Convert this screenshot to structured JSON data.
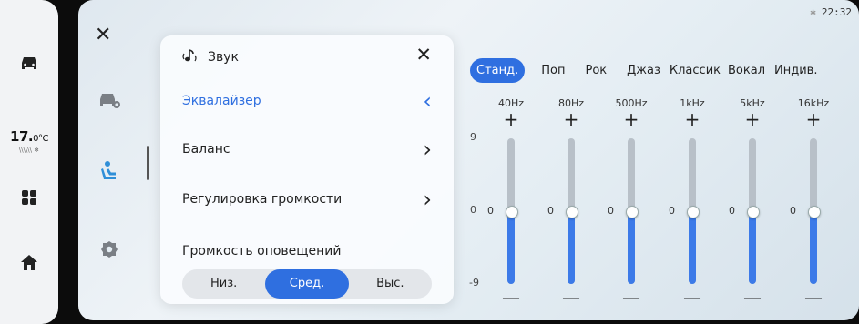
{
  "rail": {
    "temperature": "17.0°C",
    "temperature_value": "17.",
    "temperature_unit": "0°C",
    "fan_indicator": "\\\\\\\\\\\\ ❄",
    "items": [
      "car-icon",
      "temperature-display",
      "apps-grid-icon",
      "home-icon"
    ]
  },
  "status": {
    "bluetooth": "✱",
    "time": "22:32"
  },
  "sidebar_icons": [
    "car-settings-icon",
    "seat-icon",
    "gear-icon"
  ],
  "panel": {
    "title": "Звук",
    "menu": [
      {
        "label": "Эквалайзер",
        "chevron": "‹",
        "active": true
      },
      {
        "label": "Баланс",
        "chevron": "›",
        "active": false
      },
      {
        "label": "Регулировка громкости",
        "chevron": "›",
        "active": false
      }
    ],
    "notifications_label": "Громкость оповещений",
    "levels": [
      "Низ.",
      "Сред.",
      "Выс."
    ],
    "selected_level": "Сред."
  },
  "presets": {
    "items": [
      "Станд.",
      "Поп",
      "Рок",
      "Джаз",
      "Классик",
      "Вокал",
      "Индив."
    ],
    "selected": "Станд."
  },
  "equalizer": {
    "scale_max": "9",
    "scale_zero": "0",
    "scale_min": "-9",
    "range": [
      -9,
      9
    ],
    "bands": [
      {
        "freq": "40Hz",
        "value": 0,
        "label": "0"
      },
      {
        "freq": "80Hz",
        "value": 0,
        "label": "0"
      },
      {
        "freq": "500Hz",
        "value": 0,
        "label": "0"
      },
      {
        "freq": "1kHz",
        "value": 0,
        "label": "0"
      },
      {
        "freq": "5kHz",
        "value": 0,
        "label": "0"
      },
      {
        "freq": "16kHz",
        "value": 0,
        "label": "0"
      }
    ],
    "plus": "+",
    "minus": "—"
  },
  "colors": {
    "accent": "#2f6fe0",
    "track": "#b8c0c8"
  }
}
